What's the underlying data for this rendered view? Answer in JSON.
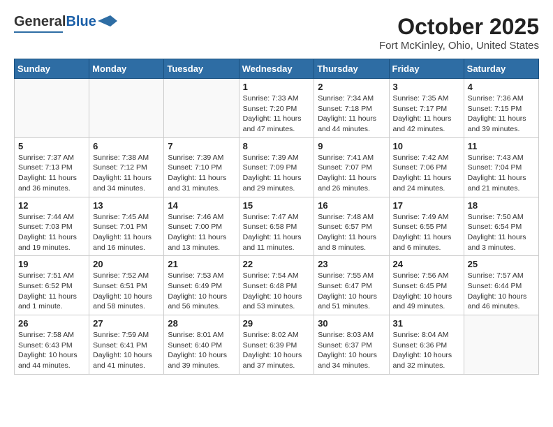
{
  "header": {
    "logo_general": "General",
    "logo_blue": "Blue",
    "month_year": "October 2025",
    "location": "Fort McKinley, Ohio, United States"
  },
  "days_of_week": [
    "Sunday",
    "Monday",
    "Tuesday",
    "Wednesday",
    "Thursday",
    "Friday",
    "Saturday"
  ],
  "weeks": [
    [
      {
        "day": "",
        "info": ""
      },
      {
        "day": "",
        "info": ""
      },
      {
        "day": "",
        "info": ""
      },
      {
        "day": "1",
        "info": "Sunrise: 7:33 AM\nSunset: 7:20 PM\nDaylight: 11 hours and 47 minutes."
      },
      {
        "day": "2",
        "info": "Sunrise: 7:34 AM\nSunset: 7:18 PM\nDaylight: 11 hours and 44 minutes."
      },
      {
        "day": "3",
        "info": "Sunrise: 7:35 AM\nSunset: 7:17 PM\nDaylight: 11 hours and 42 minutes."
      },
      {
        "day": "4",
        "info": "Sunrise: 7:36 AM\nSunset: 7:15 PM\nDaylight: 11 hours and 39 minutes."
      }
    ],
    [
      {
        "day": "5",
        "info": "Sunrise: 7:37 AM\nSunset: 7:13 PM\nDaylight: 11 hours and 36 minutes."
      },
      {
        "day": "6",
        "info": "Sunrise: 7:38 AM\nSunset: 7:12 PM\nDaylight: 11 hours and 34 minutes."
      },
      {
        "day": "7",
        "info": "Sunrise: 7:39 AM\nSunset: 7:10 PM\nDaylight: 11 hours and 31 minutes."
      },
      {
        "day": "8",
        "info": "Sunrise: 7:39 AM\nSunset: 7:09 PM\nDaylight: 11 hours and 29 minutes."
      },
      {
        "day": "9",
        "info": "Sunrise: 7:41 AM\nSunset: 7:07 PM\nDaylight: 11 hours and 26 minutes."
      },
      {
        "day": "10",
        "info": "Sunrise: 7:42 AM\nSunset: 7:06 PM\nDaylight: 11 hours and 24 minutes."
      },
      {
        "day": "11",
        "info": "Sunrise: 7:43 AM\nSunset: 7:04 PM\nDaylight: 11 hours and 21 minutes."
      }
    ],
    [
      {
        "day": "12",
        "info": "Sunrise: 7:44 AM\nSunset: 7:03 PM\nDaylight: 11 hours and 19 minutes."
      },
      {
        "day": "13",
        "info": "Sunrise: 7:45 AM\nSunset: 7:01 PM\nDaylight: 11 hours and 16 minutes."
      },
      {
        "day": "14",
        "info": "Sunrise: 7:46 AM\nSunset: 7:00 PM\nDaylight: 11 hours and 13 minutes."
      },
      {
        "day": "15",
        "info": "Sunrise: 7:47 AM\nSunset: 6:58 PM\nDaylight: 11 hours and 11 minutes."
      },
      {
        "day": "16",
        "info": "Sunrise: 7:48 AM\nSunset: 6:57 PM\nDaylight: 11 hours and 8 minutes."
      },
      {
        "day": "17",
        "info": "Sunrise: 7:49 AM\nSunset: 6:55 PM\nDaylight: 11 hours and 6 minutes."
      },
      {
        "day": "18",
        "info": "Sunrise: 7:50 AM\nSunset: 6:54 PM\nDaylight: 11 hours and 3 minutes."
      }
    ],
    [
      {
        "day": "19",
        "info": "Sunrise: 7:51 AM\nSunset: 6:52 PM\nDaylight: 11 hours and 1 minute."
      },
      {
        "day": "20",
        "info": "Sunrise: 7:52 AM\nSunset: 6:51 PM\nDaylight: 10 hours and 58 minutes."
      },
      {
        "day": "21",
        "info": "Sunrise: 7:53 AM\nSunset: 6:49 PM\nDaylight: 10 hours and 56 minutes."
      },
      {
        "day": "22",
        "info": "Sunrise: 7:54 AM\nSunset: 6:48 PM\nDaylight: 10 hours and 53 minutes."
      },
      {
        "day": "23",
        "info": "Sunrise: 7:55 AM\nSunset: 6:47 PM\nDaylight: 10 hours and 51 minutes."
      },
      {
        "day": "24",
        "info": "Sunrise: 7:56 AM\nSunset: 6:45 PM\nDaylight: 10 hours and 49 minutes."
      },
      {
        "day": "25",
        "info": "Sunrise: 7:57 AM\nSunset: 6:44 PM\nDaylight: 10 hours and 46 minutes."
      }
    ],
    [
      {
        "day": "26",
        "info": "Sunrise: 7:58 AM\nSunset: 6:43 PM\nDaylight: 10 hours and 44 minutes."
      },
      {
        "day": "27",
        "info": "Sunrise: 7:59 AM\nSunset: 6:41 PM\nDaylight: 10 hours and 41 minutes."
      },
      {
        "day": "28",
        "info": "Sunrise: 8:01 AM\nSunset: 6:40 PM\nDaylight: 10 hours and 39 minutes."
      },
      {
        "day": "29",
        "info": "Sunrise: 8:02 AM\nSunset: 6:39 PM\nDaylight: 10 hours and 37 minutes."
      },
      {
        "day": "30",
        "info": "Sunrise: 8:03 AM\nSunset: 6:37 PM\nDaylight: 10 hours and 34 minutes."
      },
      {
        "day": "31",
        "info": "Sunrise: 8:04 AM\nSunset: 6:36 PM\nDaylight: 10 hours and 32 minutes."
      },
      {
        "day": "",
        "info": ""
      }
    ]
  ]
}
